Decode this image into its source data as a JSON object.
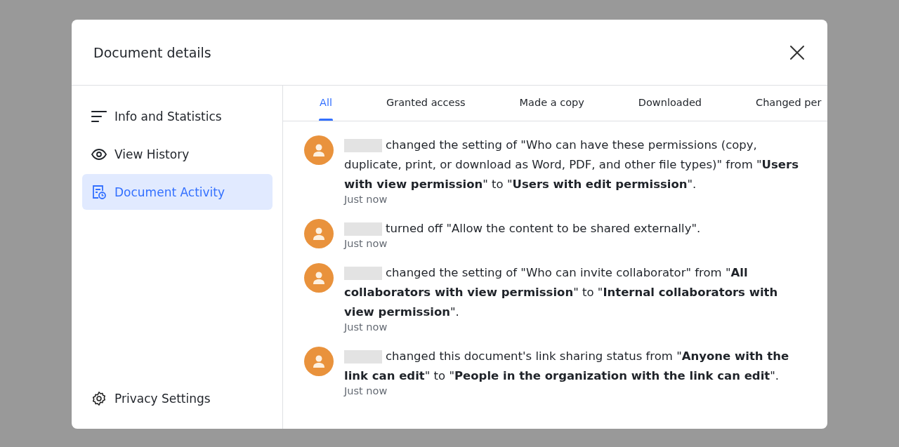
{
  "dialog": {
    "title": "Document details"
  },
  "sidebar": {
    "items": [
      {
        "label": "Info and Statistics",
        "selected": false
      },
      {
        "label": "View History",
        "selected": false
      },
      {
        "label": "Document Activity",
        "selected": true
      }
    ],
    "footer": {
      "label": "Privacy Settings"
    }
  },
  "tabs": [
    {
      "label": "All",
      "selected": true
    },
    {
      "label": "Granted access",
      "selected": false
    },
    {
      "label": "Made a copy",
      "selected": false
    },
    {
      "label": "Downloaded",
      "selected": false
    },
    {
      "label": "Changed per",
      "selected": false
    }
  ],
  "events": [
    {
      "text": "changed the setting of \"Who can have these permissions (copy, duplicate, print, or download as Word, PDF, and other file types)\" from \"**Users with view permission**\" to \"**Users with edit permission**\".",
      "time": "Just now"
    },
    {
      "text": "turned off \"Allow the content to be shared externally\".",
      "time": "Just now"
    },
    {
      "text": "changed the setting of \"Who can invite collaborator\" from \"**All collaborators with view permission**\" to \"**Internal collaborators with view permission**\".",
      "time": "Just now"
    },
    {
      "text": "changed this document's link sharing status from \"**Anyone with the link can edit**\" to \"**People in the organization with the link can edit**\".",
      "time": "Just now"
    }
  ]
}
